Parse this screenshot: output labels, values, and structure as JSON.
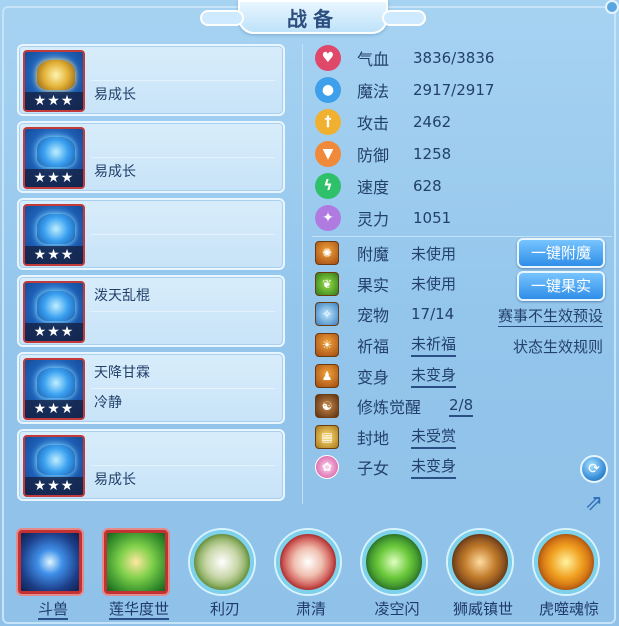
{
  "title": "战备",
  "equipment_slots": [
    {
      "stars": "★★★",
      "line1": "",
      "line2": "易成长",
      "icon": "gold-weapon-icon"
    },
    {
      "stars": "★★★",
      "line1": "",
      "line2": "易成长",
      "icon": "blue-helmet-icon"
    },
    {
      "stars": "★★★",
      "line1": "",
      "line2": "",
      "icon": "blue-necklace-icon"
    },
    {
      "stars": "★★★",
      "line1": "泼天乱棍",
      "line2": "",
      "icon": "blue-armor-icon"
    },
    {
      "stars": "★★★",
      "line1": "天降甘霖",
      "line2": "冷静",
      "icon": "blue-belt-icon"
    },
    {
      "stars": "★★★",
      "line1": "",
      "line2": "易成长",
      "icon": "blue-boots-icon"
    }
  ],
  "stats": [
    {
      "name": "气血",
      "value": "3836/3836",
      "icon": "heart-icon",
      "color": "#e0486a"
    },
    {
      "name": "魔法",
      "value": "2917/2917",
      "icon": "mana-icon",
      "color": "#3ea0ea"
    },
    {
      "name": "攻击",
      "value": "2462",
      "icon": "sword-icon",
      "color": "#f0b030"
    },
    {
      "name": "防御",
      "value": "1258",
      "icon": "shield-icon",
      "color": "#f08a3a"
    },
    {
      "name": "速度",
      "value": "628",
      "icon": "speed-icon",
      "color": "#2fc06a"
    },
    {
      "name": "灵力",
      "value": "1051",
      "icon": "spirit-icon",
      "color": "#b07be0"
    }
  ],
  "extras": {
    "enchant": {
      "name": "附魔",
      "value": "未使用",
      "button": "一键附魔",
      "icon": "enchant-icon"
    },
    "fruit": {
      "name": "果实",
      "value": "未使用",
      "button": "一键果实",
      "icon": "fruit-icon"
    },
    "pet": {
      "name": "宠物",
      "value": "17/14",
      "link": "赛事不生效预设",
      "icon": "pet-icon"
    },
    "blessing": {
      "name": "祈福",
      "value": "未祈福",
      "link": "状态生效规则",
      "icon": "blessing-icon"
    },
    "transform": {
      "name": "变身",
      "value": "未变身",
      "icon": "transform-icon"
    },
    "awakening": {
      "name": "修炼觉醒",
      "value": "2/8",
      "icon": "meditate-icon"
    },
    "territory": {
      "name": "封地",
      "value": "未受赏",
      "icon": "territory-icon"
    },
    "children": {
      "name": "子女",
      "value": "未变身",
      "icon": "lotus-icon"
    }
  },
  "skills": [
    {
      "label": "斗兽",
      "icon": "beast-orb-icon",
      "underlined": true
    },
    {
      "label": "莲华度世",
      "icon": "lotus-hand-icon",
      "underlined": true
    },
    {
      "label": "利刃",
      "icon": "blade-icon",
      "underlined": false
    },
    {
      "label": "肃清",
      "icon": "purge-icon",
      "underlined": false
    },
    {
      "label": "凌空闪",
      "icon": "flash-icon",
      "underlined": false
    },
    {
      "label": "狮威镇世",
      "icon": "lion-icon",
      "underlined": false
    },
    {
      "label": "虎噬魂惊",
      "icon": "tiger-icon",
      "underlined": false
    }
  ]
}
